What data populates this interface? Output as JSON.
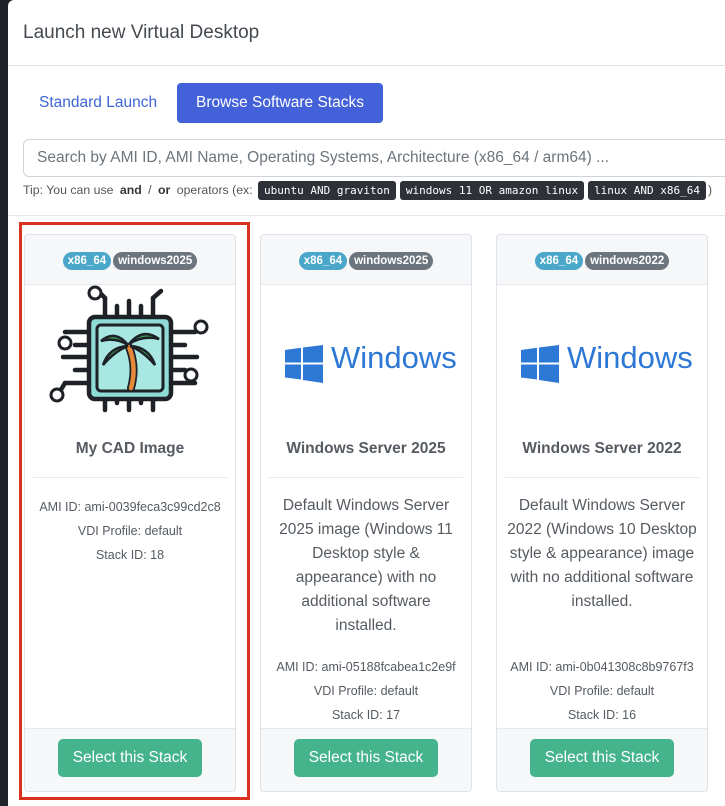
{
  "modal": {
    "title": "Launch new Virtual Desktop"
  },
  "tabs": {
    "standard": "Standard Launch",
    "browse": "Browse Software Stacks"
  },
  "search": {
    "placeholder": "Search by AMI ID, AMI Name, Operating Systems, Architecture (x86_64 / arm64) ..."
  },
  "tip": {
    "prefix": "Tip: You can use ",
    "and": "and",
    "sep": " / ",
    "or": "or",
    "middle": " operators (ex: ",
    "examples": [
      "ubuntu AND graviton",
      "windows 11 OR amazon linux",
      "linux AND x86_64"
    ],
    "suffix": ")"
  },
  "cards": [
    {
      "arch": "x86_64",
      "os": "windows2025",
      "image": "palm-chip-icon",
      "name": "My CAD Image",
      "description": "",
      "ami": "AMI ID: ami-0039feca3c99cd2c8",
      "profile": "VDI Profile: default",
      "stack": "Stack ID: 18",
      "button": "Select this Stack",
      "selected": true
    },
    {
      "arch": "x86_64",
      "os": "windows2025",
      "image": "windows-logo",
      "logo_text": "Windows",
      "name": "Windows Server 2025",
      "description": "Default Windows Server 2025 image (Windows 11 Desktop style & appearance) with no additional software installed.",
      "ami": "AMI ID: ami-05188fcabea1c2e9f",
      "profile": "VDI Profile: default",
      "stack": "Stack ID: 17",
      "button": "Select this Stack",
      "selected": false
    },
    {
      "arch": "x86_64",
      "os": "windows2022",
      "image": "windows-logo",
      "logo_text": "Windows",
      "name": "Windows Server 2022",
      "description": "Default Windows Server 2022 (Windows 10 Desktop style & appearance) image with no additional software installed.",
      "ami": "AMI ID: ami-0b041308c8b9767f3",
      "profile": "VDI Profile: default",
      "stack": "Stack ID: 16",
      "button": "Select this Stack",
      "selected": false
    }
  ],
  "colors": {
    "primary": "#4361d8",
    "success": "#45b38c",
    "arch_badge": "#4aa7c9",
    "os_badge": "#6c757d",
    "highlight": "#d8321e"
  }
}
